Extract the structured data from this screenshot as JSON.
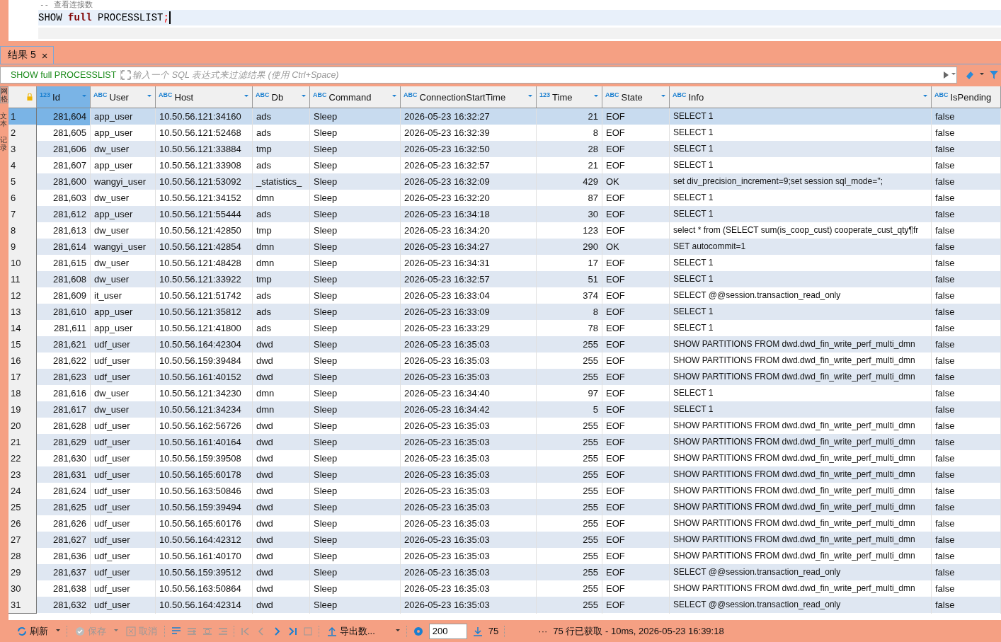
{
  "editor": {
    "comment": "--  查看连接数",
    "code": [
      {
        "text": "SHOW ",
        "kind": "plain"
      },
      {
        "text": "full",
        "kind": "keyword"
      },
      {
        "text": " PROCESSLIST",
        "kind": "plain"
      },
      {
        "text": ";",
        "kind": "punct"
      }
    ]
  },
  "side_tabs": [
    {
      "label": "网格",
      "selected": true
    },
    {
      "label": "文本",
      "selected": false
    },
    {
      "label": "记录",
      "selected": false
    }
  ],
  "result_tab": {
    "label": "结果 5",
    "close": "×",
    "selected": true
  },
  "filter": {
    "query": "SHOW full PROCESSLIST",
    "placeholder": "输入一个 SQL 表达式来过滤结果 (使用 Ctrl+Space)"
  },
  "columns": [
    {
      "label": "Id",
      "type": "123",
      "selected": true
    },
    {
      "label": "User",
      "type": "ABC",
      "selected": false
    },
    {
      "label": "Host",
      "type": "ABC",
      "selected": false
    },
    {
      "label": "Db",
      "type": "ABC",
      "selected": false
    },
    {
      "label": "Command",
      "type": "ABC",
      "selected": false
    },
    {
      "label": "ConnectionStartTime",
      "type": "ABC",
      "selected": false
    },
    {
      "label": "Time",
      "type": "123",
      "selected": false
    },
    {
      "label": "State",
      "type": "ABC",
      "selected": false
    },
    {
      "label": "Info",
      "type": "ABC",
      "selected": false
    },
    {
      "label": "IsPending",
      "type": "ABC",
      "selected": false
    }
  ],
  "rows": [
    {
      "num": "1",
      "selected": true,
      "cells": [
        "281,604",
        "app_user",
        "10.50.56.121:34160",
        "ads",
        "Sleep",
        "2026-05-23 16:32:27",
        "21",
        "EOF",
        "SELECT 1",
        "false"
      ]
    },
    {
      "num": "2",
      "selected": false,
      "cells": [
        "281,605",
        "app_user",
        "10.50.56.121:52468",
        "ads",
        "Sleep",
        "2026-05-23 16:32:39",
        "8",
        "EOF",
        "SELECT 1",
        "false"
      ]
    },
    {
      "num": "3",
      "selected": false,
      "cells": [
        "281,606",
        "dw_user",
        "10.50.56.121:33884",
        "tmp",
        "Sleep",
        "2026-05-23 16:32:50",
        "28",
        "EOF",
        "SELECT 1",
        "false"
      ]
    },
    {
      "num": "4",
      "selected": false,
      "cells": [
        "281,607",
        "app_user",
        "10.50.56.121:33908",
        "ads",
        "Sleep",
        "2026-05-23 16:32:57",
        "21",
        "EOF",
        "SELECT 1",
        "false"
      ]
    },
    {
      "num": "5",
      "selected": false,
      "cells": [
        "281,600",
        "wangyi_user",
        "10.50.56.121:53092",
        "_statistics_",
        "Sleep",
        "2026-05-23 16:32:09",
        "429",
        "OK",
        "set div_precision_increment=9;set session sql_mode='';",
        "false"
      ]
    },
    {
      "num": "6",
      "selected": false,
      "cells": [
        "281,603",
        "dw_user",
        "10.50.56.121:34152",
        "dmn",
        "Sleep",
        "2026-05-23 16:32:20",
        "87",
        "EOF",
        "SELECT 1",
        "false"
      ]
    },
    {
      "num": "7",
      "selected": false,
      "cells": [
        "281,612",
        "app_user",
        "10.50.56.121:55444",
        "ads",
        "Sleep",
        "2026-05-23 16:34:18",
        "30",
        "EOF",
        "SELECT 1",
        "false"
      ]
    },
    {
      "num": "8",
      "selected": false,
      "cells": [
        "281,613",
        "dw_user",
        "10.50.56.121:42850",
        "tmp",
        "Sleep",
        "2026-05-23 16:34:20",
        "123",
        "EOF",
        "select * from (SELECT sum(is_coop_cust) cooperate_cust_qty¶fr",
        "false"
      ]
    },
    {
      "num": "9",
      "selected": false,
      "cells": [
        "281,614",
        "wangyi_user",
        "10.50.56.121:42854",
        "dmn",
        "Sleep",
        "2026-05-23 16:34:27",
        "290",
        "OK",
        "SET autocommit=1",
        "false"
      ]
    },
    {
      "num": "10",
      "selected": false,
      "cells": [
        "281,615",
        "dw_user",
        "10.50.56.121:48428",
        "dmn",
        "Sleep",
        "2026-05-23 16:34:31",
        "17",
        "EOF",
        "SELECT 1",
        "false"
      ]
    },
    {
      "num": "11",
      "selected": false,
      "cells": [
        "281,608",
        "dw_user",
        "10.50.56.121:33922",
        "tmp",
        "Sleep",
        "2026-05-23 16:32:57",
        "51",
        "EOF",
        "SELECT 1",
        "false"
      ]
    },
    {
      "num": "12",
      "selected": false,
      "cells": [
        "281,609",
        "it_user",
        "10.50.56.121:51742",
        "ads",
        "Sleep",
        "2026-05-23 16:33:04",
        "374",
        "EOF",
        "SELECT @@session.transaction_read_only",
        "false"
      ]
    },
    {
      "num": "13",
      "selected": false,
      "cells": [
        "281,610",
        "app_user",
        "10.50.56.121:35812",
        "ads",
        "Sleep",
        "2026-05-23 16:33:09",
        "8",
        "EOF",
        "SELECT 1",
        "false"
      ]
    },
    {
      "num": "14",
      "selected": false,
      "cells": [
        "281,611",
        "app_user",
        "10.50.56.121:41800",
        "ads",
        "Sleep",
        "2026-05-23 16:33:29",
        "78",
        "EOF",
        "SELECT 1",
        "false"
      ]
    },
    {
      "num": "15",
      "selected": false,
      "cells": [
        "281,621",
        "udf_user",
        "10.50.56.164:42304",
        "dwd",
        "Sleep",
        "2026-05-23 16:35:03",
        "255",
        "EOF",
        "SHOW PARTITIONS FROM dwd.dwd_fin_write_perf_multi_dmn",
        "false"
      ]
    },
    {
      "num": "16",
      "selected": false,
      "cells": [
        "281,622",
        "udf_user",
        "10.50.56.159:39484",
        "dwd",
        "Sleep",
        "2026-05-23 16:35:03",
        "255",
        "EOF",
        "SHOW PARTITIONS FROM dwd.dwd_fin_write_perf_multi_dmn",
        "false"
      ]
    },
    {
      "num": "17",
      "selected": false,
      "cells": [
        "281,623",
        "udf_user",
        "10.50.56.161:40152",
        "dwd",
        "Sleep",
        "2026-05-23 16:35:03",
        "255",
        "EOF",
        "SHOW PARTITIONS FROM dwd.dwd_fin_write_perf_multi_dmn",
        "false"
      ]
    },
    {
      "num": "18",
      "selected": false,
      "cells": [
        "281,616",
        "dw_user",
        "10.50.56.121:34230",
        "dmn",
        "Sleep",
        "2026-05-23 16:34:40",
        "97",
        "EOF",
        "SELECT 1",
        "false"
      ]
    },
    {
      "num": "19",
      "selected": false,
      "cells": [
        "281,617",
        "dw_user",
        "10.50.56.121:34234",
        "dmn",
        "Sleep",
        "2026-05-23 16:34:42",
        "5",
        "EOF",
        "SELECT 1",
        "false"
      ]
    },
    {
      "num": "20",
      "selected": false,
      "cells": [
        "281,628",
        "udf_user",
        "10.50.56.162:56726",
        "dwd",
        "Sleep",
        "2026-05-23 16:35:03",
        "255",
        "EOF",
        "SHOW PARTITIONS FROM dwd.dwd_fin_write_perf_multi_dmn",
        "false"
      ]
    },
    {
      "num": "21",
      "selected": false,
      "cells": [
        "281,629",
        "udf_user",
        "10.50.56.161:40164",
        "dwd",
        "Sleep",
        "2026-05-23 16:35:03",
        "255",
        "EOF",
        "SHOW PARTITIONS FROM dwd.dwd_fin_write_perf_multi_dmn",
        "false"
      ]
    },
    {
      "num": "22",
      "selected": false,
      "cells": [
        "281,630",
        "udf_user",
        "10.50.56.159:39508",
        "dwd",
        "Sleep",
        "2026-05-23 16:35:03",
        "255",
        "EOF",
        "SHOW PARTITIONS FROM dwd.dwd_fin_write_perf_multi_dmn",
        "false"
      ]
    },
    {
      "num": "23",
      "selected": false,
      "cells": [
        "281,631",
        "udf_user",
        "10.50.56.165:60178",
        "dwd",
        "Sleep",
        "2026-05-23 16:35:03",
        "255",
        "EOF",
        "SHOW PARTITIONS FROM dwd.dwd_fin_write_perf_multi_dmn",
        "false"
      ]
    },
    {
      "num": "24",
      "selected": false,
      "cells": [
        "281,624",
        "udf_user",
        "10.50.56.163:50846",
        "dwd",
        "Sleep",
        "2026-05-23 16:35:03",
        "255",
        "EOF",
        "SHOW PARTITIONS FROM dwd.dwd_fin_write_perf_multi_dmn",
        "false"
      ]
    },
    {
      "num": "25",
      "selected": false,
      "cells": [
        "281,625",
        "udf_user",
        "10.50.56.159:39494",
        "dwd",
        "Sleep",
        "2026-05-23 16:35:03",
        "255",
        "EOF",
        "SHOW PARTITIONS FROM dwd.dwd_fin_write_perf_multi_dmn",
        "false"
      ]
    },
    {
      "num": "26",
      "selected": false,
      "cells": [
        "281,626",
        "udf_user",
        "10.50.56.165:60176",
        "dwd",
        "Sleep",
        "2026-05-23 16:35:03",
        "255",
        "EOF",
        "SHOW PARTITIONS FROM dwd.dwd_fin_write_perf_multi_dmn",
        "false"
      ]
    },
    {
      "num": "27",
      "selected": false,
      "cells": [
        "281,627",
        "udf_user",
        "10.50.56.164:42312",
        "dwd",
        "Sleep",
        "2026-05-23 16:35:03",
        "255",
        "EOF",
        "SHOW PARTITIONS FROM dwd.dwd_fin_write_perf_multi_dmn",
        "false"
      ]
    },
    {
      "num": "28",
      "selected": false,
      "cells": [
        "281,636",
        "udf_user",
        "10.50.56.161:40170",
        "dwd",
        "Sleep",
        "2026-05-23 16:35:03",
        "255",
        "EOF",
        "SHOW PARTITIONS FROM dwd.dwd_fin_write_perf_multi_dmn",
        "false"
      ]
    },
    {
      "num": "29",
      "selected": false,
      "cells": [
        "281,637",
        "udf_user",
        "10.50.56.159:39512",
        "dwd",
        "Sleep",
        "2026-05-23 16:35:03",
        "255",
        "EOF",
        "SELECT @@session.transaction_read_only",
        "false"
      ]
    },
    {
      "num": "30",
      "selected": false,
      "cells": [
        "281,638",
        "udf_user",
        "10.50.56.163:50864",
        "dwd",
        "Sleep",
        "2026-05-23 16:35:03",
        "255",
        "EOF",
        "SHOW PARTITIONS FROM dwd.dwd_fin_write_perf_multi_dmn",
        "false"
      ]
    },
    {
      "num": "31",
      "selected": false,
      "cells": [
        "281,632",
        "udf_user",
        "10.50.56.164:42314",
        "dwd",
        "Sleep",
        "2026-05-23 16:35:03",
        "255",
        "EOF",
        "SELECT @@session.transaction_read_only",
        "false"
      ]
    }
  ],
  "toolbar": {
    "refresh": "刷新",
    "save": {
      "label": "保存",
      "disabled": true
    },
    "cancel": {
      "label": "取消",
      "disabled": true
    },
    "export": "导出数...",
    "fetch_size": "200",
    "count": "75",
    "more": "···",
    "status": "75 行已获取 - 10ms, 2026-05-23 16:39:18"
  }
}
